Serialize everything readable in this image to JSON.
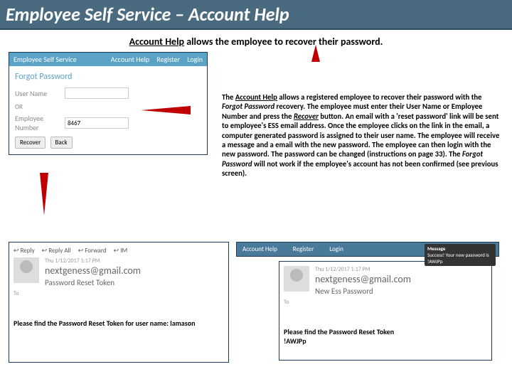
{
  "title": "Employee Self Service – Account Help",
  "subtitle": {
    "u": "Account Help",
    "rest": " allows the employee to recover their password."
  },
  "app": {
    "brand": "Employee Self Service",
    "nav": {
      "help": "Account Help",
      "register": "Register",
      "login": "Login"
    },
    "forgot_title": "Forgot Password",
    "username_label": "User Name",
    "or": "OR",
    "empnum_label": "Employee Number",
    "empnum_value": "8467",
    "recover": "Recover",
    "back": "Back"
  },
  "desc": {
    "p1a": "The ",
    "p1u": "Account Help",
    "p1b": " allows a registered employee to recover their password with the ",
    "p1i": "Forgot Password",
    "p1c": " recovery.  The employee must enter their User Name or Employee Number and press the ",
    "p1i2": "Recover",
    "p1d": " button.  An email with a 'reset password' link will be sent to employee's ESS email address.  Once the employee clicks on the link in the email, a computer generated password is assigned to their user name.  The employee will receive a message and a email with the new password.  The employee can then login with the new password.  The password can be changed (instructions on page 33).  The ",
    "p1i3": "Forgot Password",
    "p1e": " will not work if the employee's account has not been confirmed (see previous screen)."
  },
  "email1": {
    "reply": "Reply",
    "replyall": "Reply All",
    "forward": "Forward",
    "im": "IM",
    "date": "Thu 1/12/2017 1:17 PM",
    "from": "nextgeness@gmail.com",
    "subject": "Password Reset Token",
    "to": "To",
    "body": "Please find the Password Reset Token for user name: lamason"
  },
  "navstrip": {
    "help": "Account Help",
    "register": "Register",
    "login": "Login",
    "msg_title": "Message",
    "msg_body": "Success! Your new password is !AWJPp"
  },
  "email2": {
    "date": "Thu 1/12/2017 1:17 PM",
    "from": "nextgeness@gmail.com",
    "subject": "New Ess Password",
    "to": "To",
    "body1": "Please find the Password Reset Token",
    "body2": "!AWJPp"
  }
}
